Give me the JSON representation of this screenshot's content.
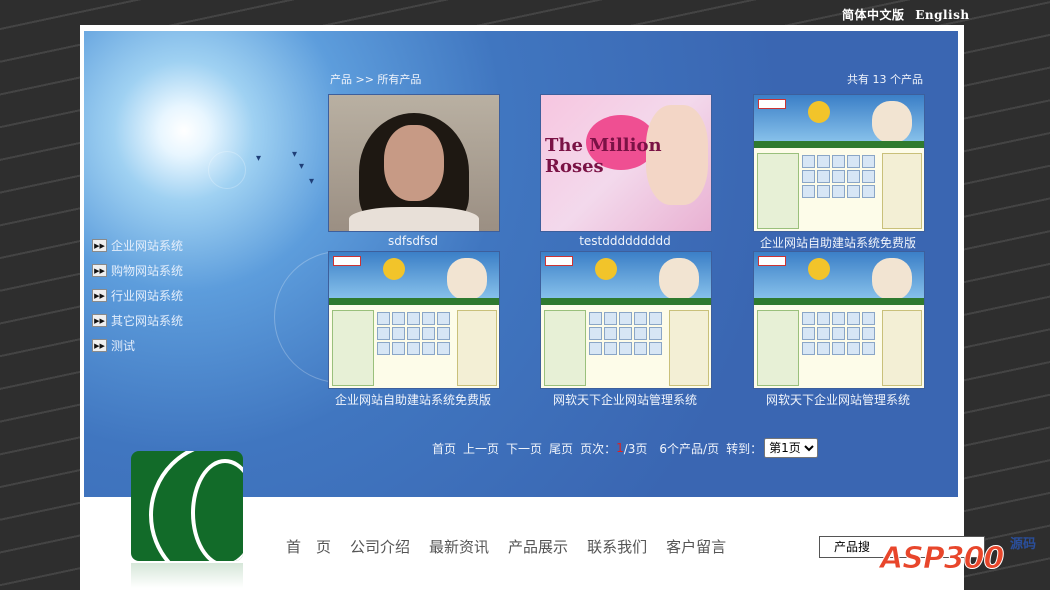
{
  "lang": {
    "cn": "简体中文版",
    "en": "English"
  },
  "breadcrumb": "产品 >> 所有产品",
  "count_text": "共有 13 个产品",
  "sidebar": {
    "items": [
      {
        "label": "企业网站系统"
      },
      {
        "label": "购物网站系统"
      },
      {
        "label": "行业网站系统"
      },
      {
        "label": "其它网站系统"
      },
      {
        "label": "测试"
      }
    ]
  },
  "products": [
    {
      "label": "sdfsdfsd",
      "thumb": "face"
    },
    {
      "label": "testddddddddd",
      "thumb": "roses"
    },
    {
      "label": "企业网站自助建站系统免费版",
      "thumb": "site"
    },
    {
      "label": "企业网站自助建站系统免费版",
      "thumb": "site"
    },
    {
      "label": "网软天下企业网站管理系统",
      "thumb": "site"
    },
    {
      "label": "网软天下企业网站管理系统",
      "thumb": "site"
    }
  ],
  "roses_text": "The Million Roses",
  "pager": {
    "first": "首页",
    "prev": "上一页",
    "next": "下一页",
    "last": "尾页",
    "page_prefix": "页次：",
    "current": "1",
    "total": "/3页",
    "per_page": "6个产品/页",
    "goto": "转到：",
    "select_value": "第1页"
  },
  "mainnav": {
    "items": [
      "首　页",
      "公司介绍",
      "最新资讯",
      "产品展示",
      "联系我们",
      "客户留言"
    ]
  },
  "search": {
    "label": "产品搜"
  },
  "brand": {
    "asp": "ASP300",
    "yuanma": "源码"
  }
}
